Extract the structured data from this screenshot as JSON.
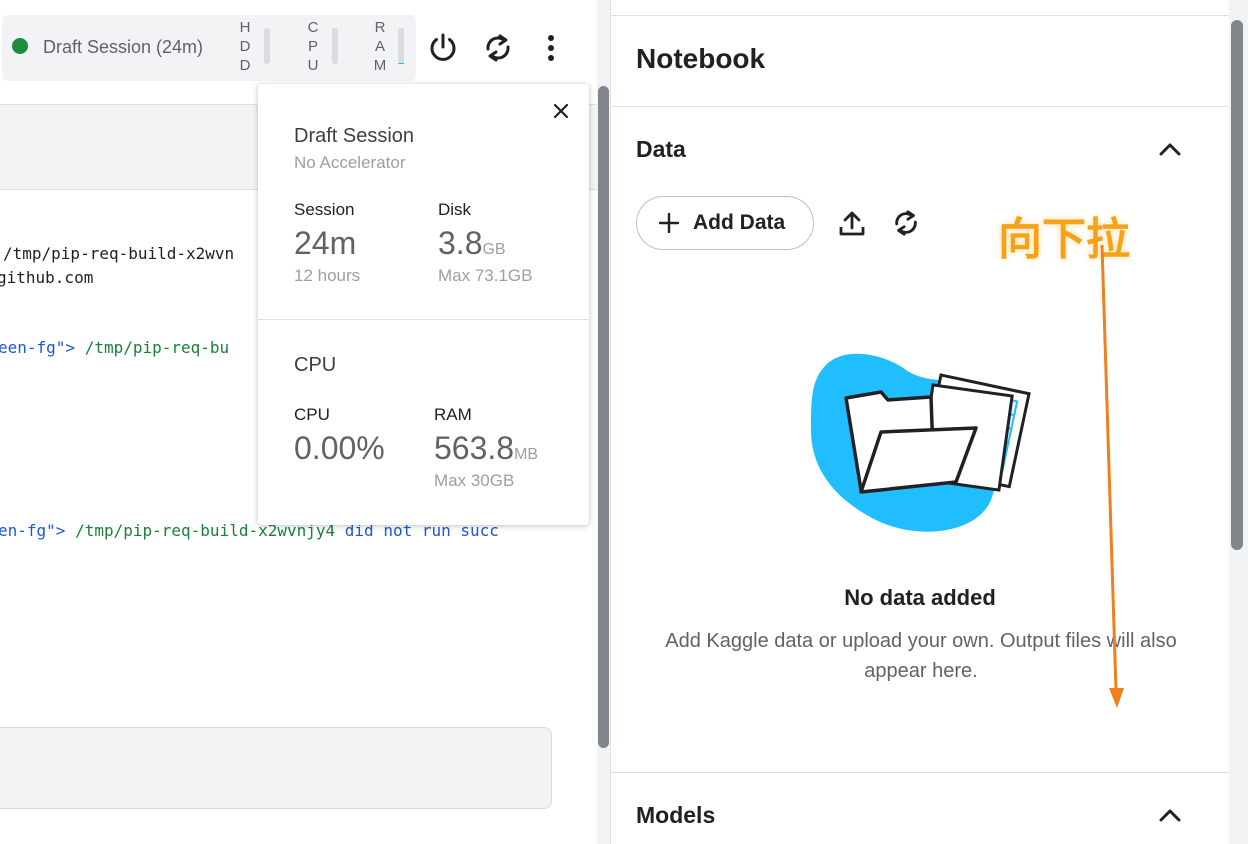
{
  "toolbar": {
    "session_label": "Draft Session (24m)",
    "meters": [
      {
        "name": "hdd",
        "letters": [
          "H",
          "D",
          "D"
        ],
        "level": 0.0
      },
      {
        "name": "cpu",
        "letters": [
          "C",
          "P",
          "U"
        ],
        "level": 0.0
      },
      {
        "name": "ram",
        "letters": [
          "R",
          "A",
          "M"
        ],
        "level": 0.03
      }
    ],
    "icons": [
      "power-icon",
      "restart-icon",
      "more-vert-icon"
    ],
    "status_color": "#1e8e3e"
  },
  "editor": {
    "code_lines": {
      "l1": "/tmp/pip-req-build-x2wvn",
      "l2": "github.com",
      "l3a": "een-fg\">",
      "l3b": " /tmp/pip-req-bu",
      "l4a": "en-fg\">",
      "l4b": " /tmp/pip-req-build-x2wvnjy4",
      "l4c": " did not run succ"
    }
  },
  "popup": {
    "title": "Draft Session",
    "subtitle": "No Accelerator",
    "session_label": "Session",
    "session_value": "24m",
    "session_limit": "12 hours",
    "disk_label": "Disk",
    "disk_value": "3.8",
    "disk_unit": "GB",
    "disk_max": "Max 73.1GB",
    "cpu_section": "CPU",
    "cpu_label": "CPU",
    "cpu_value": "0.00%",
    "ram_label": "RAM",
    "ram_value": "563.8",
    "ram_unit": "MB",
    "ram_max": "Max 30GB"
  },
  "panel": {
    "title": "Notebook",
    "data_section": "Data",
    "add_data_label": "Add Data",
    "empty_title": "No data added",
    "empty_desc": "Add Kaggle data or upload your own. Output files will also appear here.",
    "models_section": "Models"
  },
  "annotation": {
    "text": "向下拉",
    "color": "#f5a21a",
    "arrow_color": "#f07f1e"
  },
  "colors": {
    "accent": "#20beff",
    "illustration_blob": "#20beff"
  }
}
